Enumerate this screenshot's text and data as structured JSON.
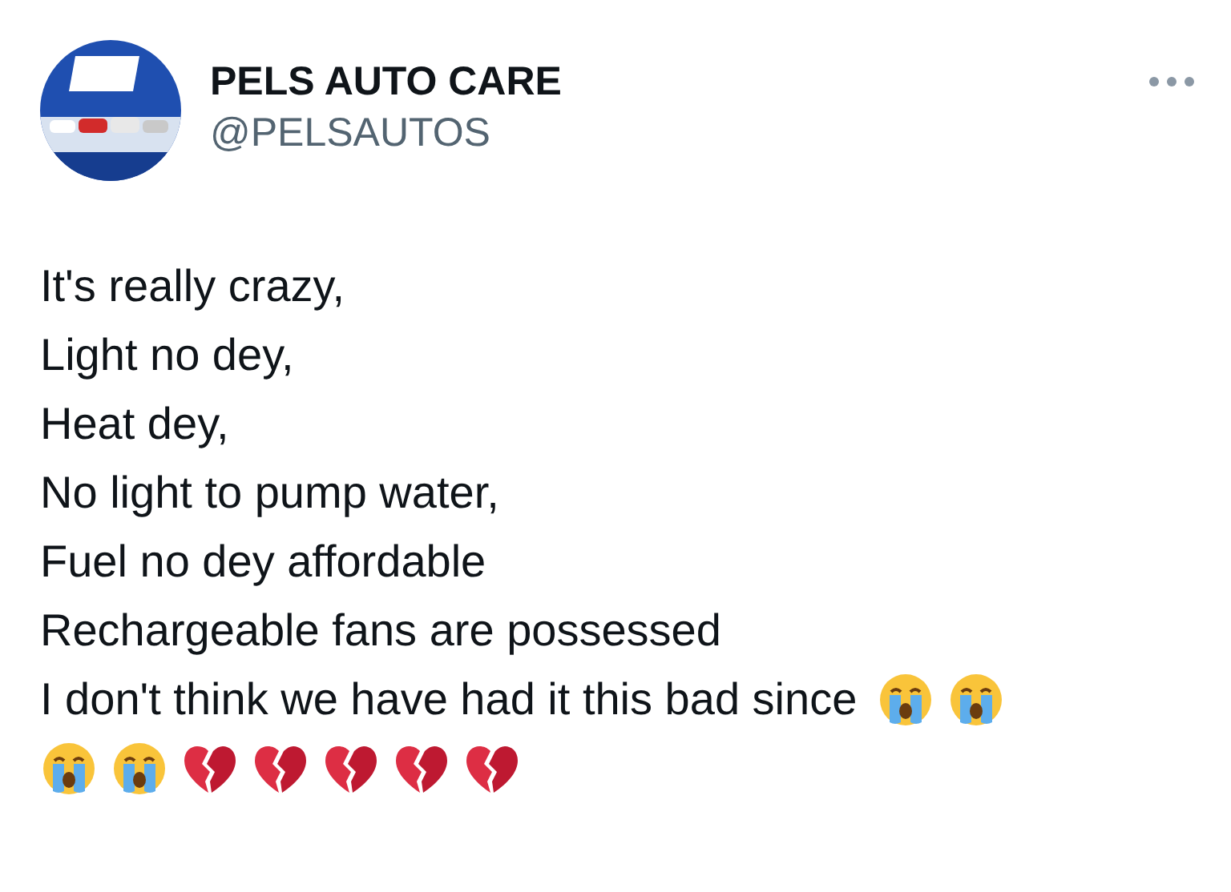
{
  "author": {
    "name": "PELS AUTO CARE",
    "handle": "@PELSAUTOS"
  },
  "body": {
    "lines": [
      {
        "text": "It's really crazy,"
      },
      {
        "text": "Light no dey,"
      },
      {
        "text": "Heat dey,"
      },
      {
        "text": "No light to pump water,"
      },
      {
        "text": "Fuel no dey affordable"
      },
      {
        "text": "Rechargeable fans are possessed"
      },
      {
        "text": "I don't think we have had it this bad since",
        "emojis": [
          {
            "kind": "crying"
          },
          {
            "kind": "crying"
          }
        ]
      },
      {
        "emojis": [
          {
            "kind": "crying"
          },
          {
            "kind": "crying"
          },
          {
            "kind": "broken-heart"
          },
          {
            "kind": "broken-heart"
          },
          {
            "kind": "broken-heart"
          },
          {
            "kind": "broken-heart"
          },
          {
            "kind": "broken-heart"
          }
        ]
      }
    ]
  }
}
